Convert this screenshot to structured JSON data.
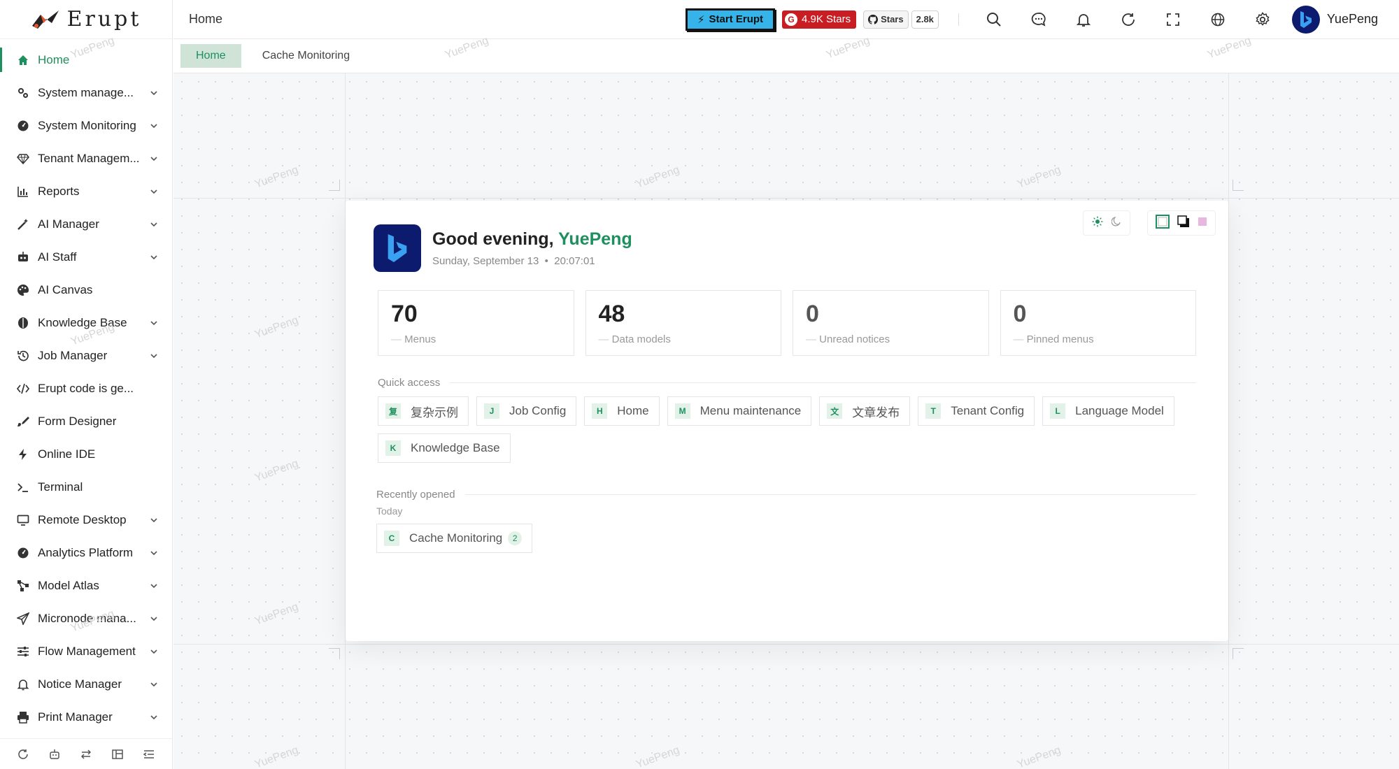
{
  "app": {
    "logo_text": "Erupt"
  },
  "sidebar": {
    "items": [
      {
        "label": "Home",
        "icon": "home-icon",
        "active": true,
        "expandable": false
      },
      {
        "label": "System manage...",
        "icon": "gears-icon",
        "expandable": true
      },
      {
        "label": "System Monitoring",
        "icon": "dashboard-icon",
        "expandable": true
      },
      {
        "label": "Tenant Managem...",
        "icon": "diamond-icon",
        "expandable": true
      },
      {
        "label": "Reports",
        "icon": "bar-chart-icon",
        "expandable": true
      },
      {
        "label": "AI Manager",
        "icon": "magic-wand-icon",
        "expandable": true
      },
      {
        "label": "AI Staff",
        "icon": "robot-icon",
        "expandable": true
      },
      {
        "label": "AI Canvas",
        "icon": "palette-icon",
        "expandable": false
      },
      {
        "label": "Knowledge Base",
        "icon": "book-icon",
        "expandable": true
      },
      {
        "label": "Job Manager",
        "icon": "history-icon",
        "expandable": true
      },
      {
        "label": "Erupt code is ge...",
        "icon": "code-icon",
        "expandable": false
      },
      {
        "label": "Form Designer",
        "icon": "brush-icon",
        "expandable": false
      },
      {
        "label": "Online IDE",
        "icon": "bolt-icon",
        "expandable": false
      },
      {
        "label": "Terminal",
        "icon": "terminal-icon",
        "expandable": false
      },
      {
        "label": "Remote Desktop",
        "icon": "monitor-icon",
        "expandable": true
      },
      {
        "label": "Analytics Platform",
        "icon": "dashboard-icon",
        "expandable": true
      },
      {
        "label": "Model Atlas",
        "icon": "network-icon",
        "expandable": true
      },
      {
        "label": "Micronode mana...",
        "icon": "send-icon",
        "expandable": true
      },
      {
        "label": "Flow Management",
        "icon": "sliders-icon",
        "expandable": true
      },
      {
        "label": "Notice Manager",
        "icon": "bell-icon",
        "expandable": true
      },
      {
        "label": "Print Manager",
        "icon": "printer-icon",
        "expandable": true
      }
    ],
    "footer_icons": [
      "refresh-icon",
      "robot-icon",
      "swap-icon",
      "layout-icon",
      "menu-fold-icon"
    ]
  },
  "header": {
    "breadcrumb": "Home",
    "start_button": "Start Erupt",
    "gitee_stars": "4.9K Stars",
    "github_label": "Stars",
    "github_count": "2.8k",
    "user_name": "YuePeng"
  },
  "tabs": [
    {
      "label": "Home",
      "active": true
    },
    {
      "label": "Cache Monitoring",
      "active": false
    }
  ],
  "watermark": "YuePeng",
  "dashboard": {
    "greeting_prefix": "Good evening, ",
    "greeting_name": "YuePeng",
    "date": "Sunday, September 13",
    "time": "20:07:01",
    "stats": [
      {
        "value": "70",
        "label": "Menus"
      },
      {
        "value": "48",
        "label": "Data models"
      },
      {
        "value": "0",
        "label": "Unread notices"
      },
      {
        "value": "0",
        "label": "Pinned menus"
      }
    ],
    "quick_access_title": "Quick access",
    "quick_access": [
      {
        "letter": "复",
        "label": "复杂示例"
      },
      {
        "letter": "J",
        "label": "Job Config"
      },
      {
        "letter": "H",
        "label": "Home"
      },
      {
        "letter": "M",
        "label": "Menu maintenance"
      },
      {
        "letter": "文",
        "label": "文章发布"
      },
      {
        "letter": "T",
        "label": "Tenant Config"
      },
      {
        "letter": "L",
        "label": "Language Model"
      },
      {
        "letter": "K",
        "label": "Knowledge Base"
      }
    ],
    "recent_title": "Recently opened",
    "recent_group": "Today",
    "recent": [
      {
        "letter": "C",
        "label": "Cache Monitoring",
        "count": "2"
      }
    ]
  },
  "colors": {
    "accent": "#1e8f5e",
    "start_button": "#36b3e8",
    "gitee": "#c71d23"
  }
}
